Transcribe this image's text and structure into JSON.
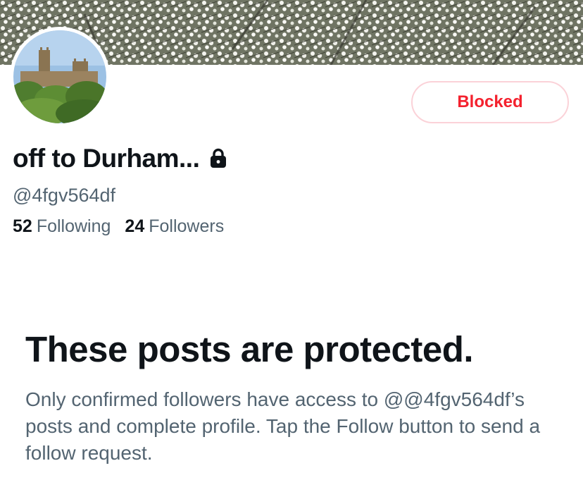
{
  "profile": {
    "display_name": "off to Durham...",
    "handle": "@4fgv564df",
    "following_count": "52",
    "following_label": "Following",
    "followers_count": "24",
    "followers_label": "Followers",
    "blocked_label": "Blocked",
    "locked": true
  },
  "protected": {
    "title": "These posts are protected.",
    "body": "Only confirmed followers have access to @@4fgv564df’s posts and complete profile. Tap the Follow button to send a follow request."
  },
  "icons": {
    "lock": "lock-icon"
  },
  "colors": {
    "text_primary": "#0f1419",
    "text_secondary": "#536471",
    "blocked_red": "#f4212e",
    "blocked_border": "#fbd2d8"
  }
}
